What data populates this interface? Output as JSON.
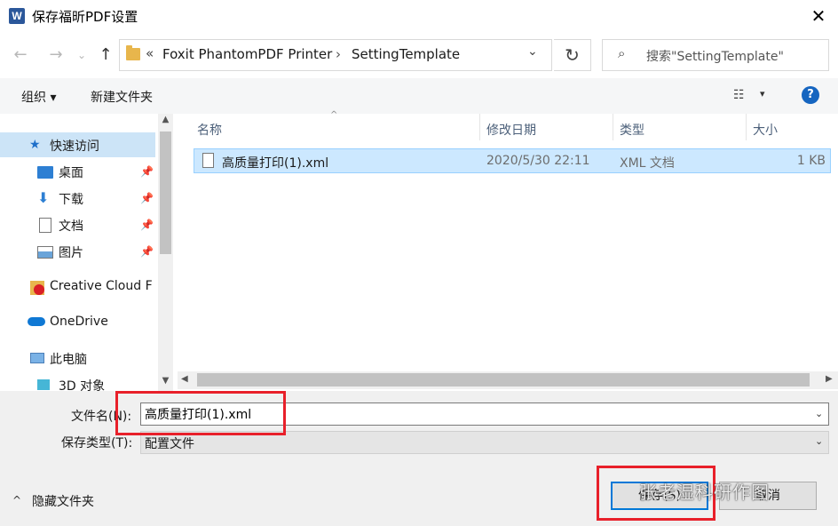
{
  "window": {
    "app_icon_letter": "W",
    "title": "保存福昕PDF设置",
    "close_glyph": "✕"
  },
  "navigation": {
    "back_glyph": "←",
    "forward_glyph": "→",
    "recent_glyph": "⌄",
    "up_glyph": "↑",
    "breadcrumb_overflow": "«",
    "breadcrumbs": [
      "Foxit PhantomPDF Printer",
      "SettingTemplate"
    ],
    "breadcrumb_separator": "›",
    "dropdown_glyph": "⌄",
    "refresh_glyph": "↻",
    "search_icon_glyph": "⌕",
    "search_placeholder": "搜索\"SettingTemplate\""
  },
  "toolbar": {
    "organize_label": "组织 ▾",
    "new_folder_label": "新建文件夹",
    "view_glyph": "☷",
    "view_caret": "▾",
    "help_label": "?"
  },
  "nav_pane": {
    "quick_access": "快速访问",
    "quick_access_icon": "★",
    "items": [
      {
        "label": "桌面",
        "icon": "desktop-icon"
      },
      {
        "label": "下载",
        "icon": "download-icon",
        "glyph": "⬇"
      },
      {
        "label": "文档",
        "icon": "document-icon"
      },
      {
        "label": "图片",
        "icon": "pictures-icon"
      }
    ],
    "pin_glyph": "📌",
    "creative_cloud": "Creative Cloud F",
    "onedrive": "OneDrive",
    "this_pc": "此电脑",
    "objects_3d": "3D 对象",
    "scroll_up": "▲",
    "scroll_down": "▼"
  },
  "file_list": {
    "columns": {
      "name": "名称",
      "date": "修改日期",
      "type": "类型",
      "size": "大小"
    },
    "sort_caret": "^",
    "rows": [
      {
        "name": "高质量打印(1).xml",
        "date": "2020/5/30 22:11",
        "type": "XML 文档",
        "size": "1 KB"
      }
    ],
    "hscroll_left": "◀",
    "hscroll_right": "▶"
  },
  "form": {
    "filename_label": "文件名(N):",
    "filename_value": "高质量打印(1).xml",
    "filename_caret": "⌄",
    "filetype_label": "保存类型(T):",
    "filetype_value": "配置文件",
    "filetype_caret": "⌄",
    "hide_folders_caret": "^",
    "hide_folders_label": "隐藏文件夹",
    "save_label": "保存(S)",
    "cancel_label": "取消"
  },
  "overlay": {
    "watermark": "张老湿科研作图",
    "highlight_color": "#e8202a"
  }
}
